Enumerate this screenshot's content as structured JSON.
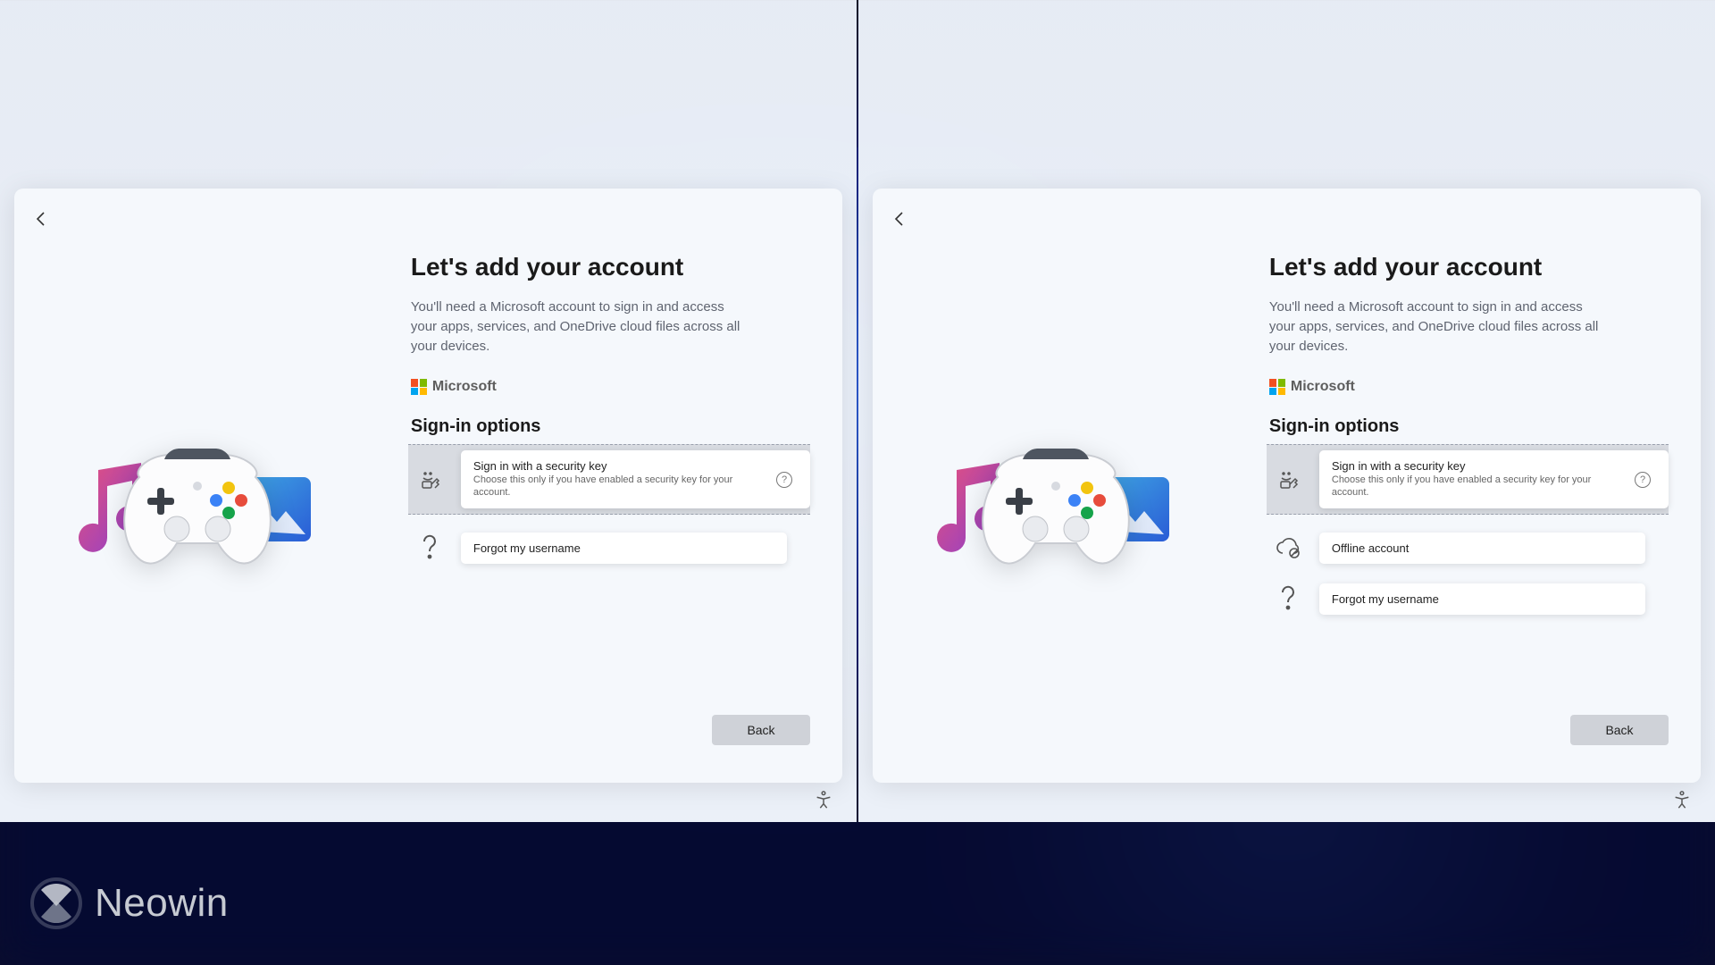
{
  "watermark": {
    "text": "Neowin"
  },
  "left": {
    "heading": "Let's add your account",
    "subtext": "You'll need a Microsoft account to sign in and access your apps, services, and OneDrive cloud files across all your devices.",
    "brand": "Microsoft",
    "signin_heading": "Sign-in options",
    "options": {
      "security": {
        "title": "Sign in with a security key",
        "sub": "Choose this only if you have enabled a security key for your account."
      },
      "forgot": {
        "title": "Forgot my username"
      }
    },
    "back_label": "Back"
  },
  "right": {
    "heading": "Let's add your account",
    "subtext": "You'll need a Microsoft account to sign in and access your apps, services, and OneDrive cloud files across all your devices.",
    "brand": "Microsoft",
    "signin_heading": "Sign-in options",
    "options": {
      "security": {
        "title": "Sign in with a security key",
        "sub": "Choose this only if you have enabled a security key for your account."
      },
      "offline": {
        "title": "Offline account"
      },
      "forgot": {
        "title": "Forgot my username"
      }
    },
    "back_label": "Back"
  }
}
